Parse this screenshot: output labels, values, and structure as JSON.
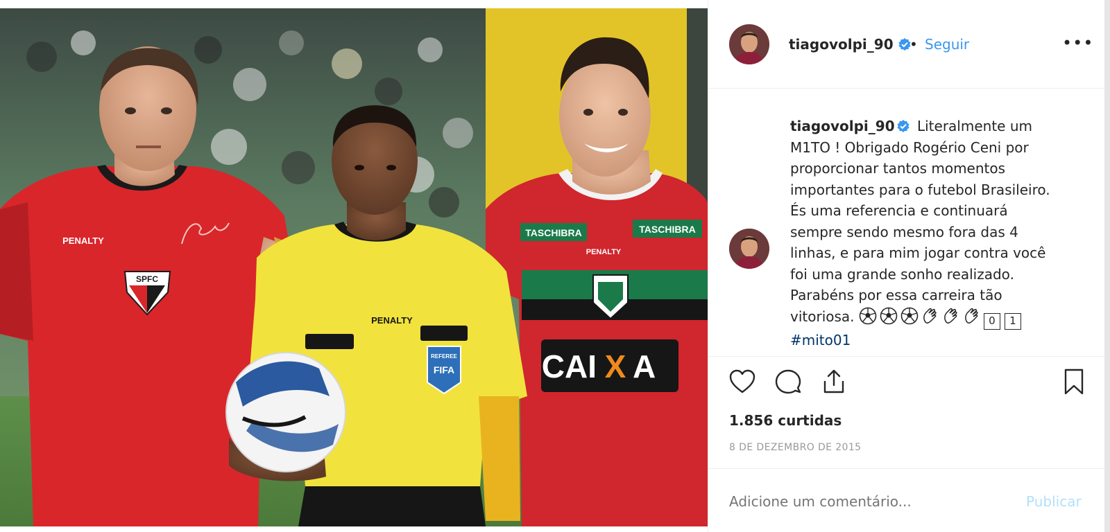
{
  "post": {
    "username": "tiagovolpi_90",
    "follow_label": "Seguir",
    "separator": "•",
    "more_label": "•••",
    "caption_lines": [
      "Literalmente um",
      "M1TO ! Obrigado Rogério Ceni por",
      "proporcionar tantos momentos",
      "importantes para o futebol Brasileiro.",
      "És uma referencia e continuará",
      "sempre sendo mesmo fora das 4",
      "linhas, e para mim jogar contra você",
      "foi uma grande sonho realizado.",
      "Parabéns por essa carreira tão",
      "vitoriosa."
    ],
    "caption_emojis": [
      "soccer-ball-icon",
      "soccer-ball-icon",
      "soccer-ball-icon",
      "clapping-hands-icon",
      "clapping-hands-icon",
      "clapping-hands-icon"
    ],
    "keycaps": [
      "0",
      "1"
    ],
    "hashtag": "#mito01",
    "likes": "1.856 curtidas",
    "date": "8 DE DEZEMBRO DE 2015",
    "comment_placeholder": "Adicione um comentário...",
    "publish_label": "Publicar"
  },
  "photo": {
    "jersey_texts": {
      "left_brand": "PENALTY",
      "left_crest": "SPFC",
      "ref_brand": "PENALTY",
      "ref_badge_top": "REFEREE",
      "ref_badge": "FIFA",
      "right_sponsor_1": "TASCHIBRA",
      "right_sponsor_2": "TASCHIBRA",
      "right_brand": "PENALTY",
      "right_main_sponsor_a": "CAI",
      "right_main_sponsor_x": "X",
      "right_main_sponsor_b": "A"
    }
  },
  "colors": {
    "link_blue": "#3897f0",
    "verified_blue": "#3897f0",
    "hashtag": "#003569",
    "publish_disabled": "#b2dffc",
    "muted": "#999999"
  }
}
